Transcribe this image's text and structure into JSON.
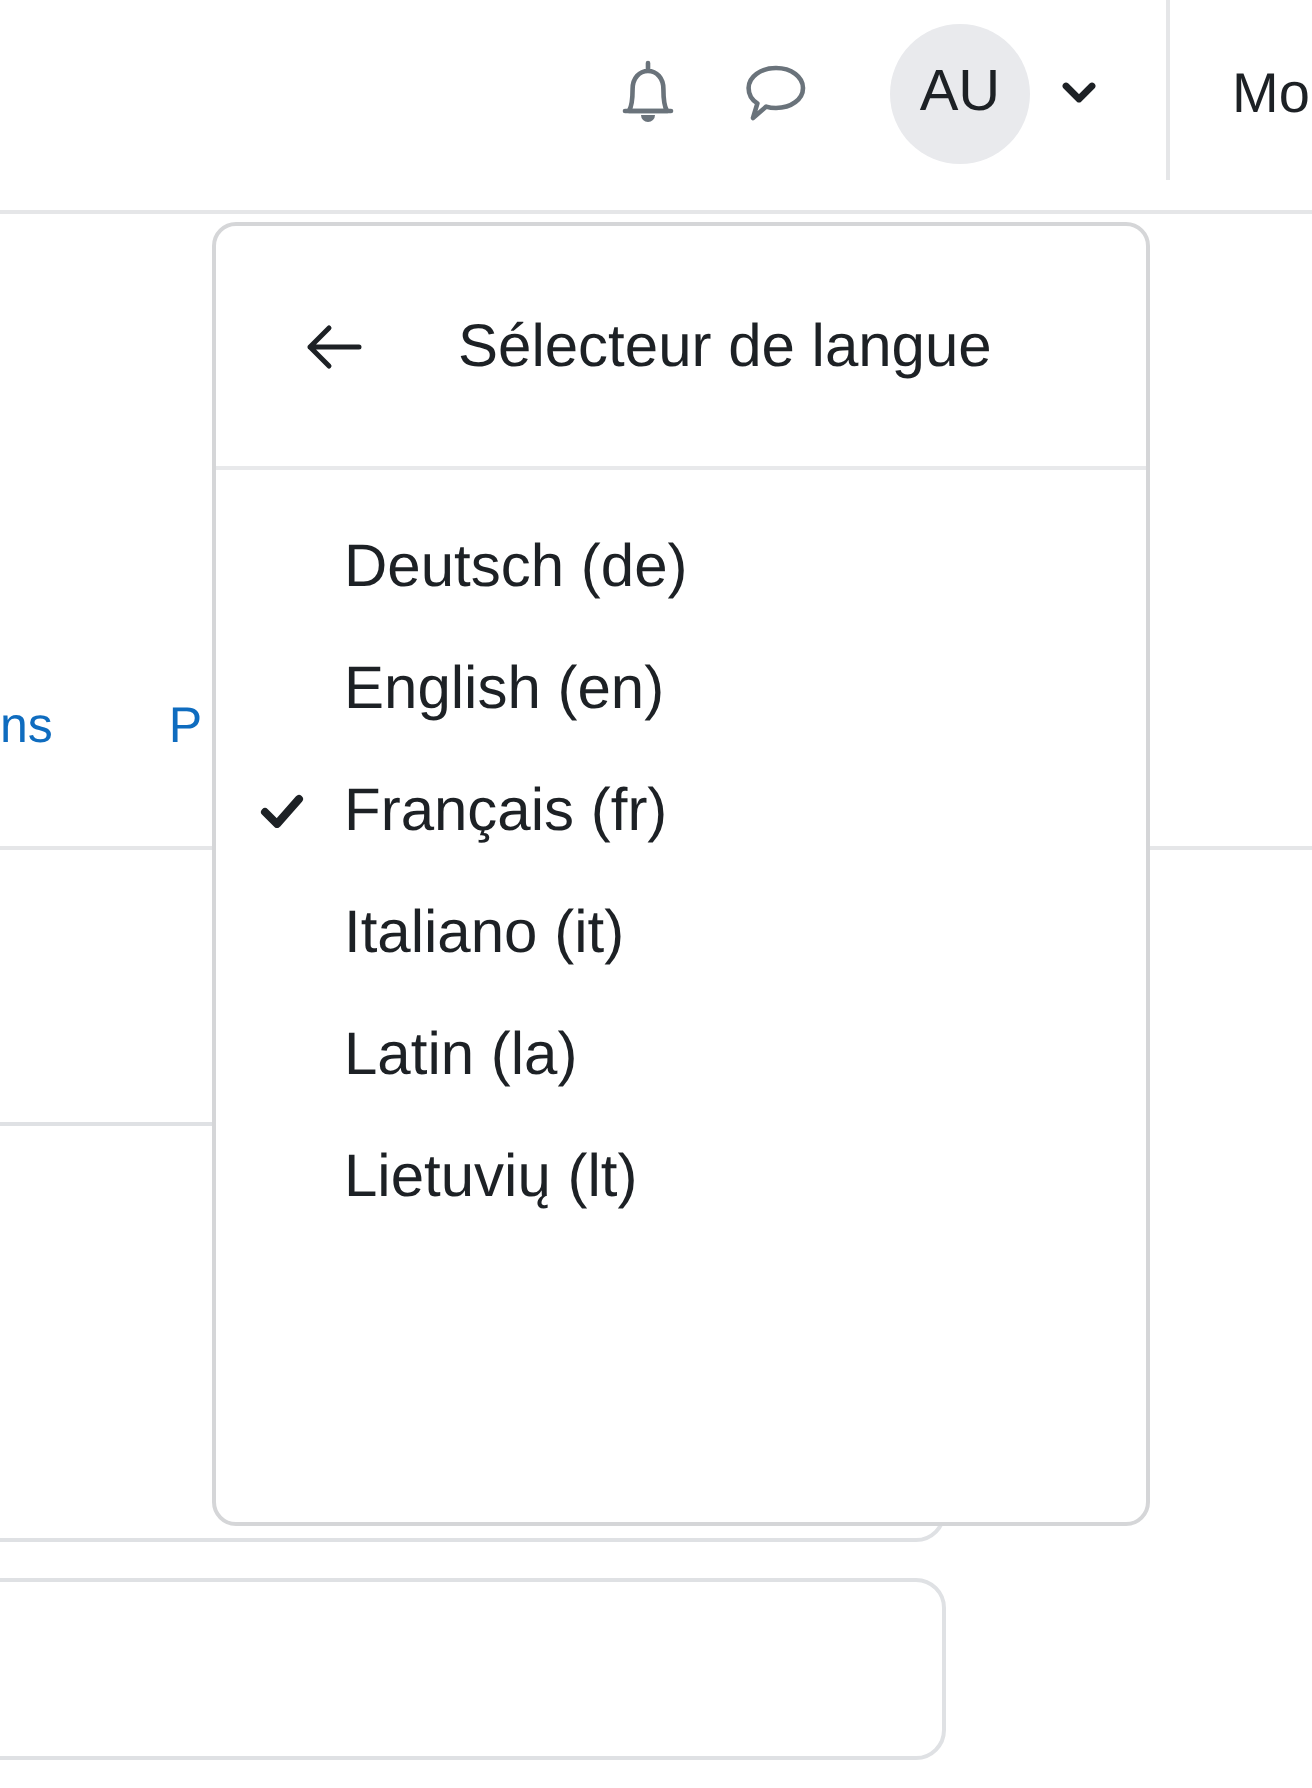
{
  "navbar": {
    "avatar": {
      "initials": "AU"
    },
    "label": "Mo"
  },
  "secondary_nav": {
    "items": [
      {
        "label": "ns"
      },
      {
        "label": "P"
      }
    ]
  },
  "language_menu": {
    "title": "Sélecteur de langue",
    "items": [
      {
        "label": "Deutsch (de)",
        "selected": false
      },
      {
        "label": "English (en)",
        "selected": false
      },
      {
        "label": "Français (fr)",
        "selected": true
      },
      {
        "label": "Italiano (it)",
        "selected": false
      },
      {
        "label": "Latin (la)",
        "selected": false
      },
      {
        "label": "Lietuvių (lt)",
        "selected": false
      }
    ]
  }
}
